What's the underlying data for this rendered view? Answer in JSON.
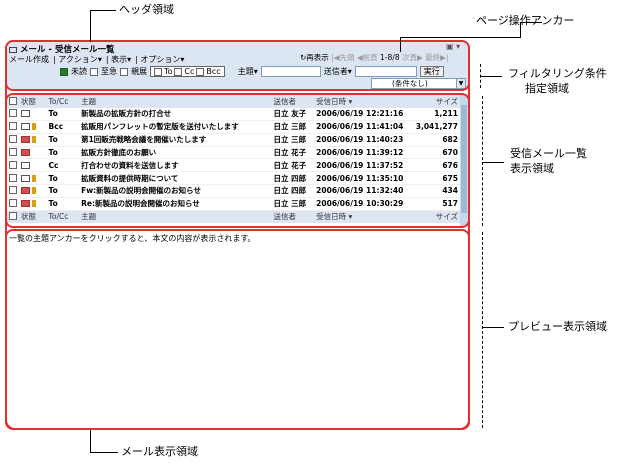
{
  "callouts": {
    "header": "ヘッダ領域",
    "pager": "ページ操作アンカー",
    "filter_line1": "フィルタリング条件",
    "filter_line2": "指定領域",
    "list_line1": "受信メール一覧",
    "list_line2": "表示領域",
    "preview": "プレビュー表示領域",
    "mail": "メール表示領域"
  },
  "header": {
    "title": "メール - 受信メール一覧",
    "menus": [
      "メール作成",
      "アクション▾",
      "表示▾",
      "オプション▾"
    ],
    "redisplay": "再表示",
    "pager_first": "先頭",
    "pager_prev": "前頁",
    "pager_range": "1-8/8",
    "pager_next": "次頁",
    "pager_last": "最終"
  },
  "filter": {
    "unread": "未読",
    "urgent": "至急",
    "confidential": "親展",
    "to": "To",
    "cc": "Cc",
    "bcc": "Bcc",
    "subject_label": "主題▾",
    "sender_label": "送信者▾",
    "execute": "実行",
    "condition": "(条件なし)"
  },
  "table": {
    "headers": {
      "status": "状態",
      "tocc": "To/Cc",
      "subject": "主題",
      "from": "送信者",
      "date": "受信日時 ▾",
      "size": "サイズ"
    },
    "rows": [
      {
        "status": "read",
        "flag": false,
        "tocc": "To",
        "subject": "新製品の拡販方針の打合せ",
        "from": "日立 友子",
        "date": "2006/06/19 12:21:16",
        "size": "1,211"
      },
      {
        "status": "reply",
        "flag": true,
        "tocc": "Bcc",
        "subject": "拡販用パンフレットの暫定版を送付いたします",
        "from": "日立 三郎",
        "date": "2006/06/19 11:41:04",
        "size": "3,041,277"
      },
      {
        "status": "unread",
        "flag": true,
        "tocc": "To",
        "subject": "第1回販売戦略会議を開催いたします",
        "from": "日立 三郎",
        "date": "2006/06/19 11:40:23",
        "size": "682"
      },
      {
        "status": "unread",
        "flag": false,
        "tocc": "To",
        "subject": "拡販方針徹底のお願い",
        "from": "日立 花子",
        "date": "2006/06/19 11:39:12",
        "size": "670"
      },
      {
        "status": "reply",
        "flag": false,
        "tocc": "Cc",
        "subject": "打合わせの資料を送信します",
        "from": "日立 花子",
        "date": "2006/06/19 11:37:52",
        "size": "676"
      },
      {
        "status": "reply",
        "flag": true,
        "tocc": "To",
        "subject": "拡販資料の提供時期について",
        "from": "日立 四郎",
        "date": "2006/06/19 11:35:10",
        "size": "675"
      },
      {
        "status": "unread",
        "flag": true,
        "tocc": "To",
        "subject": "Fw:新製品の説明会開催のお知らせ",
        "from": "日立 四郎",
        "date": "2006/06/19 11:32:40",
        "size": "434"
      },
      {
        "status": "unread",
        "flag": true,
        "tocc": "To",
        "subject": "Re:新製品の説明会開催のお知らせ",
        "from": "日立 三郎",
        "date": "2006/06/19 10:30:29",
        "size": "517"
      }
    ]
  },
  "preview": {
    "text": "一覧の主題アンカーをクリックすると、本文の内容が表示されます。"
  }
}
